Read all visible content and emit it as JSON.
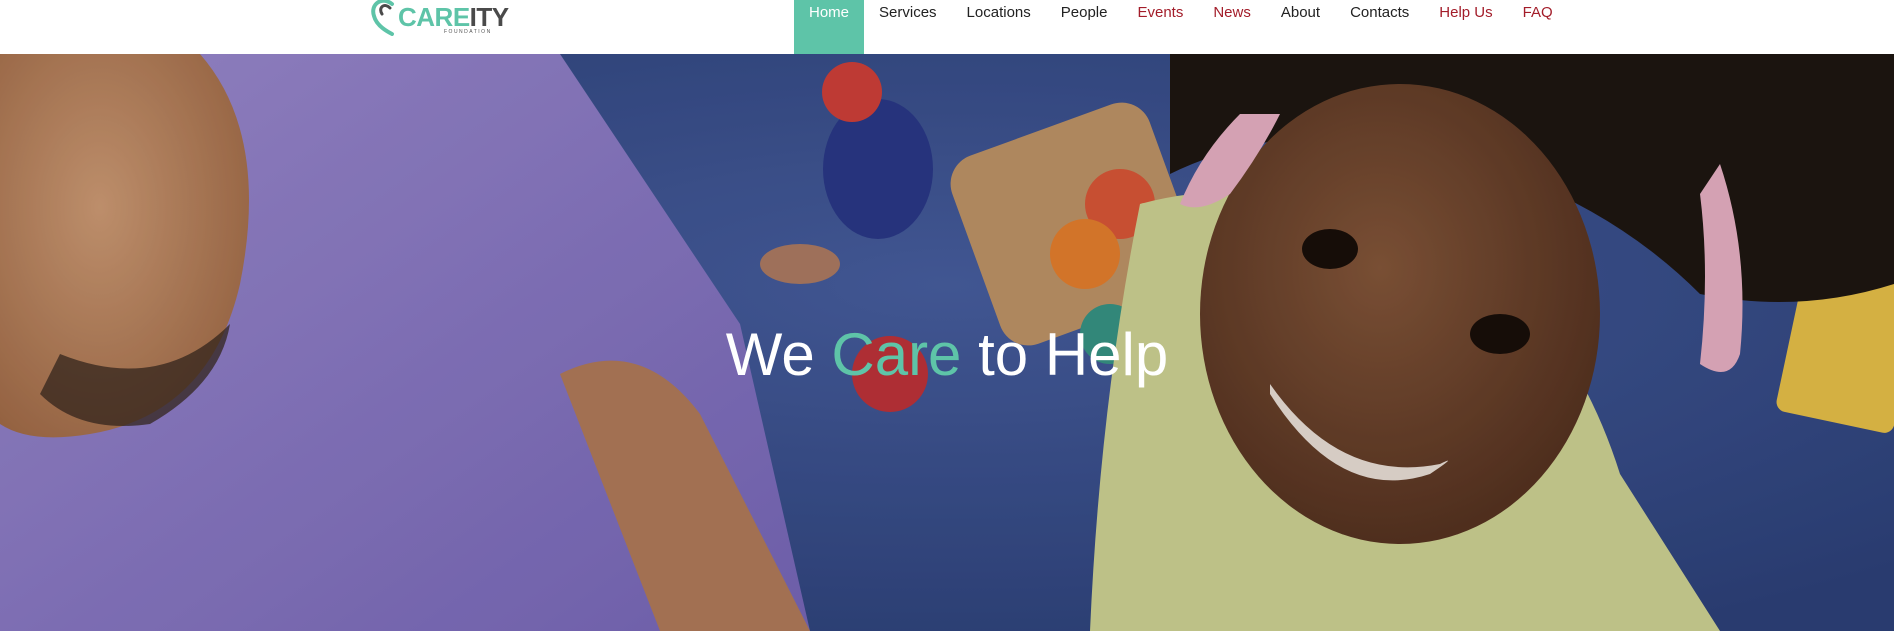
{
  "brand": {
    "logo_care": "CARE",
    "logo_ity": "ITY",
    "logo_sub": "FOUNDATION",
    "accent_color": "#5ec4a8",
    "nav_red_color": "#a31d2a"
  },
  "nav": {
    "items": [
      {
        "label": "Home",
        "active": true
      },
      {
        "label": "Services"
      },
      {
        "label": "Locations"
      },
      {
        "label": "People"
      },
      {
        "label": "Events",
        "highlight": "red"
      },
      {
        "label": "News",
        "highlight": "red"
      },
      {
        "label": "About"
      },
      {
        "label": "Contacts"
      },
      {
        "label": "Help Us",
        "highlight": "red"
      },
      {
        "label": "FAQ",
        "highlight": "red"
      }
    ]
  },
  "hero": {
    "title_pre": "We ",
    "title_accent": "Care",
    "title_post": " to Help",
    "image": "man-and-smiling-girl-photo"
  }
}
